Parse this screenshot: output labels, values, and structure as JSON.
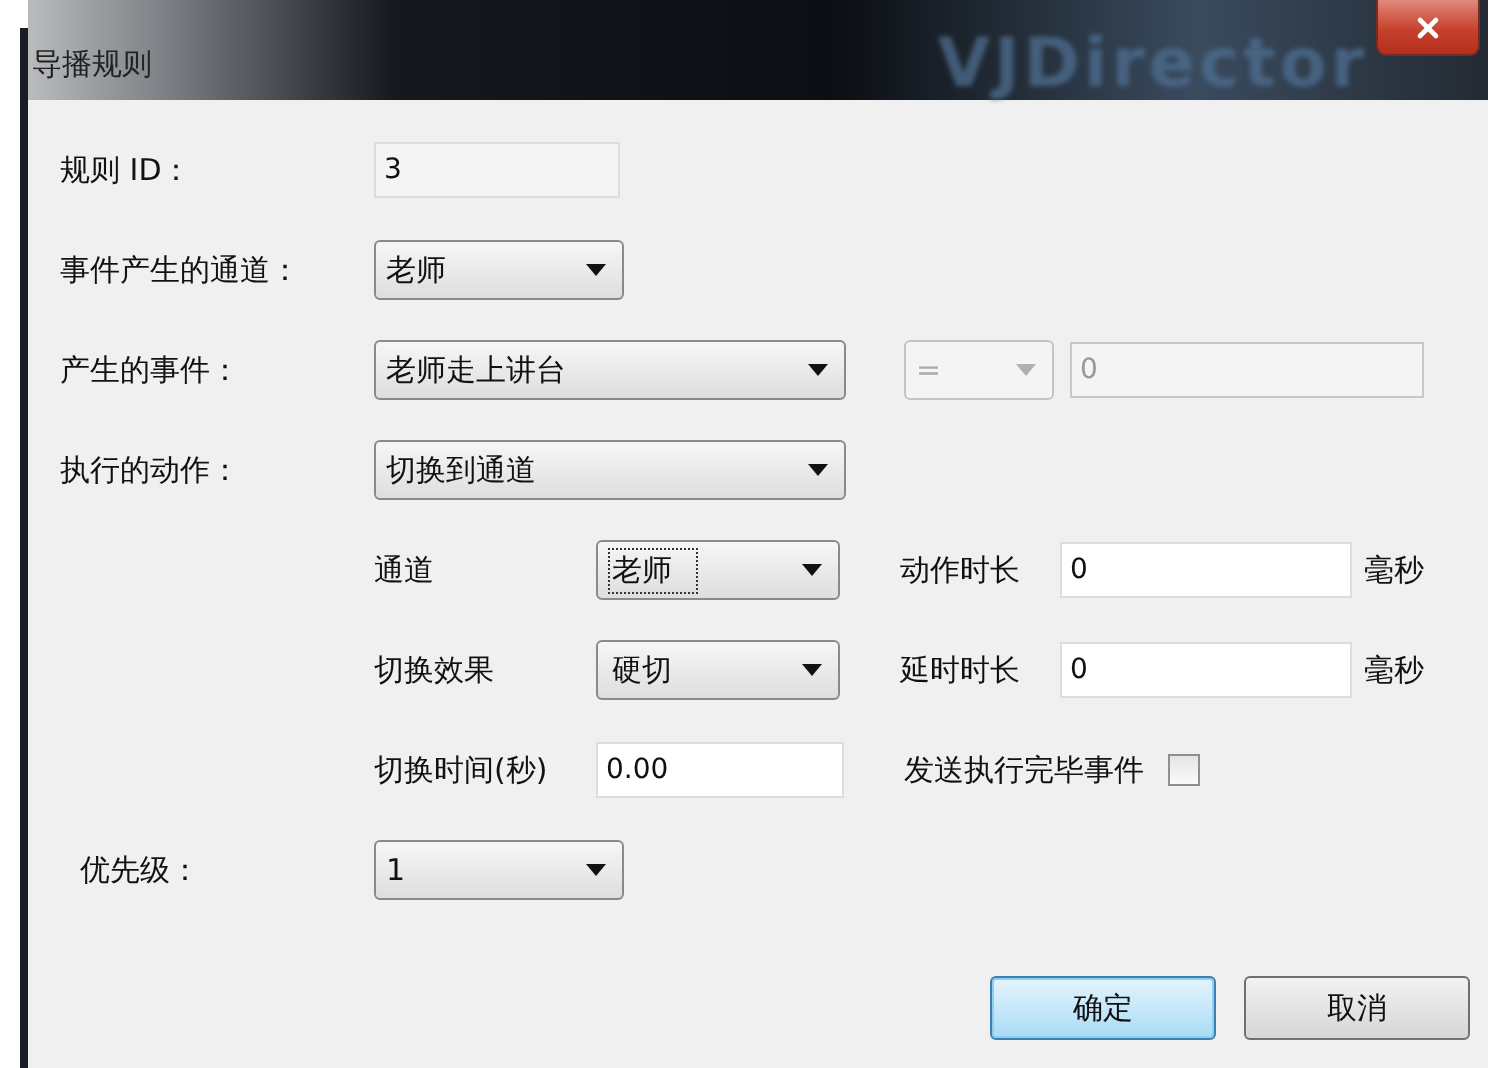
{
  "window": {
    "title": "导播规则",
    "logo": "VJDirector"
  },
  "rule_id": {
    "label": "规则 ID：",
    "value": "3"
  },
  "event_channel": {
    "label": "事件产生的通道：",
    "value": "老师"
  },
  "event": {
    "label": "产生的事件：",
    "value": "老师走上讲台",
    "operator": {
      "value": "=",
      "disabled": true
    },
    "operand": {
      "value": "0",
      "disabled": true
    }
  },
  "action": {
    "label": "执行的动作：",
    "value": "切换到通道",
    "params": [
      [
        {
          "label": "通道",
          "kind": "combo",
          "value": "老师",
          "focused": true
        },
        {
          "label": "动作时长",
          "kind": "text",
          "value": "0",
          "unit": "毫秒"
        }
      ],
      [
        {
          "label": "切换效果",
          "kind": "combo",
          "value": "硬切",
          "focused": false
        },
        {
          "label": "延时时长",
          "kind": "text",
          "value": "0",
          "unit": "毫秒"
        }
      ],
      [
        {
          "label": "切换时间(秒)",
          "kind": "text",
          "value": "0.00"
        },
        {
          "label": "发送执行完毕事件",
          "kind": "checkbox",
          "checked": false
        }
      ]
    ]
  },
  "priority": {
    "label": "优先级：",
    "value": "1"
  },
  "buttons": [
    {
      "label": "确定",
      "default": true
    },
    {
      "label": "取消",
      "default": false
    }
  ]
}
